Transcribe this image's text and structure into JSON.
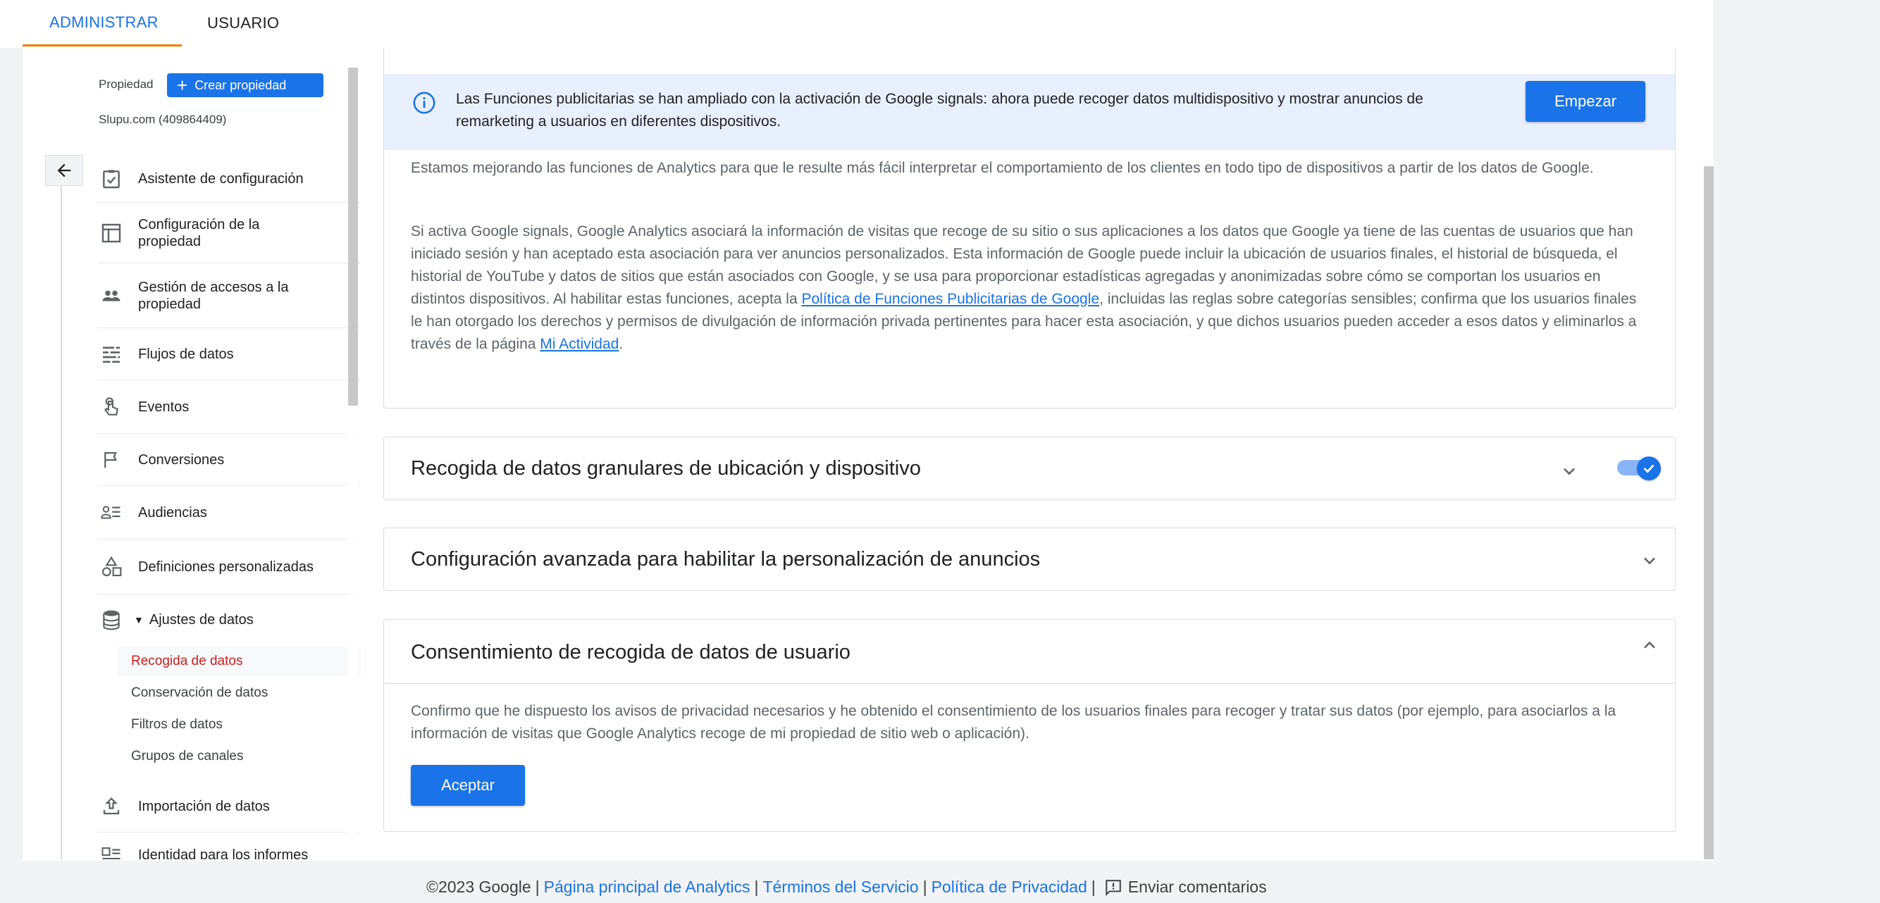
{
  "tabs": {
    "admin": "ADMINISTRAR",
    "user": "USUARIO"
  },
  "sidebar": {
    "property_label": "Propiedad",
    "create_property": "Crear propiedad",
    "property_name": "Slupu.com (409864409)",
    "items": [
      {
        "label": "Asistente de configuración",
        "icon": "checklist-icon"
      },
      {
        "label": "Configuración de la propiedad",
        "icon": "layout-icon"
      },
      {
        "label": "Gestión de accesos a la propiedad",
        "icon": "people-icon"
      },
      {
        "label": "Flujos de datos",
        "icon": "streams-icon"
      },
      {
        "label": "Eventos",
        "icon": "touch-icon"
      },
      {
        "label": "Conversiones",
        "icon": "flag-icon"
      },
      {
        "label": "Audiencias",
        "icon": "audience-icon"
      },
      {
        "label": "Definiciones personalizadas",
        "icon": "shapes-icon"
      },
      {
        "label": "Ajustes de datos",
        "icon": "database-icon"
      },
      {
        "label": "Importación de datos",
        "icon": "upload-icon"
      },
      {
        "label": "Identidad para los informes",
        "icon": "identity-icon"
      }
    ],
    "sub_items": [
      "Recogida de datos",
      "Conservación de datos",
      "Filtros de datos",
      "Grupos de canales"
    ]
  },
  "main": {
    "info_banner": "Las Funciones publicitarias se han ampliado con la activación de Google signals: ahora puede recoger datos multidispositivo y mostrar anuncios de remarketing a usuarios en diferentes dispositivos.",
    "start_button": "Empezar",
    "para1": "Estamos mejorando las funciones de Analytics para que le resulte más fácil interpretar el comportamiento de los clientes en todo tipo de dispositivos a partir de los datos de Google.",
    "para2_a": "Si activa Google signals, Google Analytics asociará la información de visitas que recoge de su sitio o sus aplicaciones a los datos que Google ya tiene de las cuentas de usuarios que han iniciado sesión y han aceptado esta asociación para ver anuncios personalizados. Esta información de Google puede incluir la ubicación de usuarios finales, el historial de búsqueda, el historial de YouTube y datos de sitios que están asociados con Google, y se usa para proporcionar estadísticas agregadas y anonimizadas sobre cómo se comportan los usuarios en distintos dispositivos. Al habilitar estas funciones, acepta la ",
    "para2_link1": "Política de Funciones Publicitarias de Google",
    "para2_b": ", incluidas las reglas sobre categorías sensibles; confirma que los usuarios finales le han otorgado los derechos y permisos de divulgación de información privada pertinentes para hacer esta asociación, y que dichos usuarios pueden acceder a esos datos y eliminarlos a través de la página ",
    "para2_link2": "Mi Actividad",
    "para2_c": ".",
    "card_granular": "Recogida de datos granulares de ubicación y dispositivo",
    "card_advanced": "Configuración avanzada para habilitar la personalización de anuncios",
    "card_consent": "Consentimiento de recogida de datos de usuario",
    "consent_text": "Confirmo que he dispuesto los avisos de privacidad necesarios y he obtenido el consentimiento de los usuarios finales para recoger y tratar sus datos (por ejemplo, para asociarlos a la información de visitas que Google Analytics recoge de mi propiedad de sitio web o aplicación).",
    "accept_button": "Aceptar",
    "granular_toggle_on": true
  },
  "footer": {
    "copyright": "©2023 Google",
    "sep": "|",
    "link1": "Página principal de Analytics",
    "link2": "Términos del Servicio",
    "link3": "Política de Privacidad",
    "feedback": "Enviar comentarios"
  },
  "colors": {
    "accent": "#1a73e8",
    "tab_underline": "#f57c00",
    "active_sub": "#c5221f",
    "banner_bg": "#e8f0fe"
  }
}
